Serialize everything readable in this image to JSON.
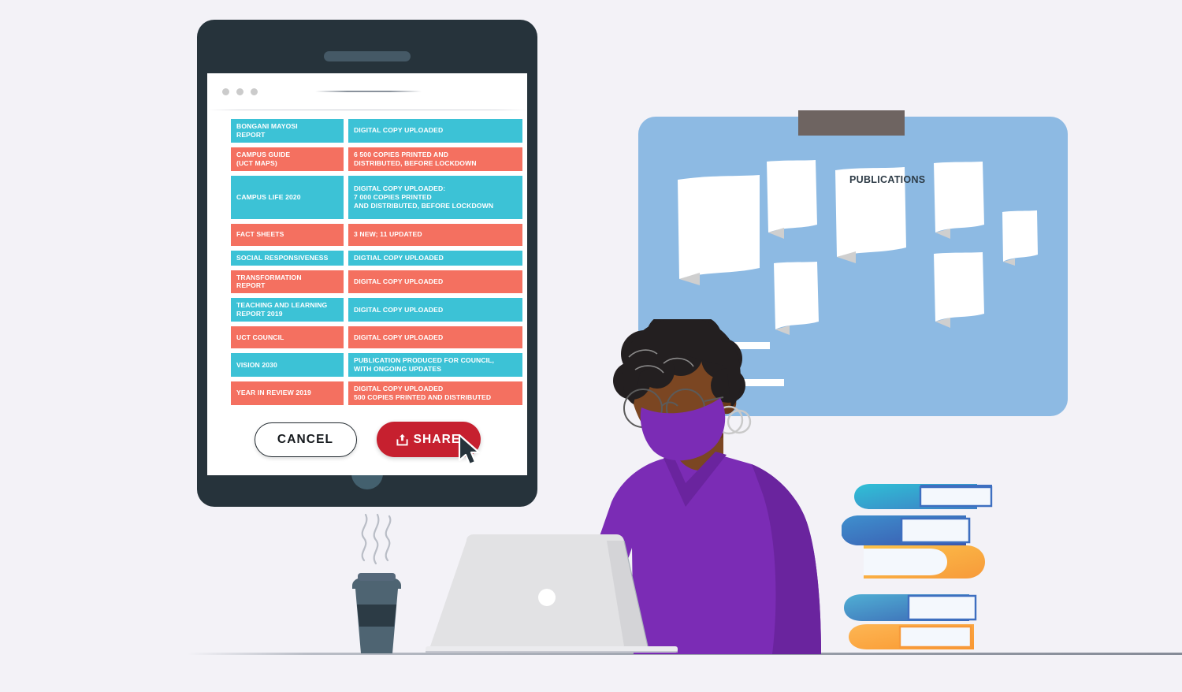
{
  "scene": {
    "background_color": "#F3F2F7",
    "desk_line_color": "#9AA0AB"
  },
  "tablet": {
    "frame_color": "#26333B",
    "home_button_color": "#43606E",
    "speaker_color": "#455966",
    "browser": {
      "dot_color": "#CBCBCB",
      "dots": [
        "window-dot",
        "window-dot",
        "window-dot"
      ],
      "url_bar_value": ""
    }
  },
  "table": {
    "teal_color": "#3CC2D6",
    "coral_color": "#F47060",
    "rows": [
      {
        "name": "BONGANI MAYOSI\nREPORT",
        "value": "DIGITAL COPY UPLOADED",
        "color": "teal"
      },
      {
        "name": "CAMPUS GUIDE\n (UCT MAPS)",
        "value": "6 500 COPIES PRINTED AND\n DISTRIBUTED, BEFORE LOCKDOWN",
        "color": "coral"
      },
      {
        "name": "CAMPUS LIFE 2020",
        "value": "DIGITAL COPY UPLOADED:\n7 000 COPIES PRINTED\nAND DISTRIBUTED, BEFORE LOCKDOWN",
        "color": "teal"
      },
      {
        "name": "FACT SHEETS",
        "value": "3 NEW; 11 UPDATED",
        "color": "coral"
      },
      {
        "name": "SOCIAL RESPONSIVENESS",
        "value": "DIGTIAL COPY UPLOADED",
        "color": "teal"
      },
      {
        "name": "TRANSFORMATION\nREPORT",
        "value": "DIGITAL COPY UPLOADED",
        "color": "coral"
      },
      {
        "name": "TEACHING AND LEARNING\nREPORT 2019",
        "value": "DIGITAL COPY UPLOADED",
        "color": "teal"
      },
      {
        "name": " UCT COUNCIL",
        "value": "DIGITAL COPY UPLOADED",
        "color": "coral"
      },
      {
        "name": "VISION 2030",
        "value": "PUBLICATION PRODUCED FOR COUNCIL,\nWITH ONGOING UPDATES",
        "color": "teal"
      },
      {
        "name": "YEAR IN REVIEW 2019",
        "value": "DIGITAL COPY UPLOADED\n500 COPIES PRINTED AND DISTRIBUTED",
        "color": "coral"
      }
    ]
  },
  "actions": {
    "cancel_label": "CANCEL",
    "share_label": "SHARE",
    "share_color": "#C6202F",
    "share_icon": "share-upload-icon",
    "cursor": "mouse-pointer-icon"
  },
  "board": {
    "label": "PUBLICATIONS",
    "board_color": "#8DBAE3",
    "clip_color": "#6E6461",
    "paper_color": "#FFFFFF",
    "paper_count": 7
  },
  "person": {
    "skin_color": "#7B4622",
    "hair_color": "#231F20",
    "shirt_color": "#7B2CB5",
    "mask_color": "#7B2CB5"
  },
  "objects": {
    "laptop_color": "#E2E2E4",
    "coffee_cup_color": "#4E6472",
    "books": [
      {
        "spine_color": "#3FB3CE",
        "page_color": "#F4F8FD",
        "flipped": false
      },
      {
        "spine_color": "#3F72B8",
        "page_color": "#F4F8FD",
        "flipped": false
      },
      {
        "spine_color": "#FBB040",
        "page_color": "#F4F8FD",
        "flipped": true
      },
      {
        "spine_color": "#4483C4",
        "page_color": "#F4F8FD",
        "flipped": false
      },
      {
        "spine_color": "#FBA94C",
        "page_color": "#F4F8FD",
        "flipped": false
      }
    ]
  }
}
